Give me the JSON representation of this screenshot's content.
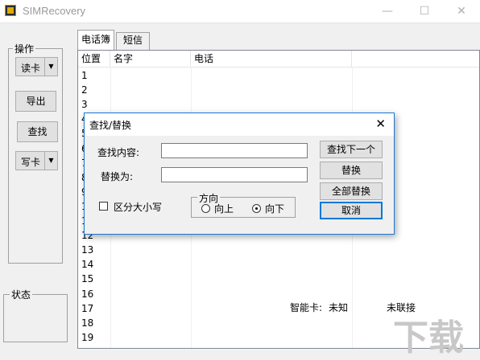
{
  "window": {
    "title": "SIMRecovery",
    "minimize": "—",
    "maximize": "☐",
    "close": "✕"
  },
  "left_panel": {
    "ops_group": "操作",
    "read_card": "读卡",
    "export": "导出",
    "find": "查找",
    "write_card": "写卡",
    "status_group": "状态"
  },
  "tabs": [
    "电话簿",
    "短信"
  ],
  "table": {
    "columns": [
      "位置",
      "名字",
      "电话"
    ],
    "rows": [
      "1",
      "2",
      "3",
      "4",
      "5",
      "6",
      "7",
      "8",
      "9",
      "10",
      "11",
      "12",
      "13",
      "14",
      "15",
      "16",
      "17",
      "18",
      "19"
    ]
  },
  "dialog": {
    "title": "查找/替换",
    "find_label": "查找内容:",
    "replace_label": "替换为:",
    "find_value": "",
    "replace_value": "",
    "case_label": "区分大小写",
    "direction_label": "方向",
    "up_label": "向上",
    "down_label": "向下",
    "btn_find_next": "查找下一个",
    "btn_replace": "替换",
    "btn_replace_all": "全部替换",
    "btn_cancel": "取消",
    "close": "✕"
  },
  "status": {
    "smart_card_label": "智能卡:",
    "smart_card_value": "未知",
    "connection": "未联接"
  },
  "watermark": "下载"
}
